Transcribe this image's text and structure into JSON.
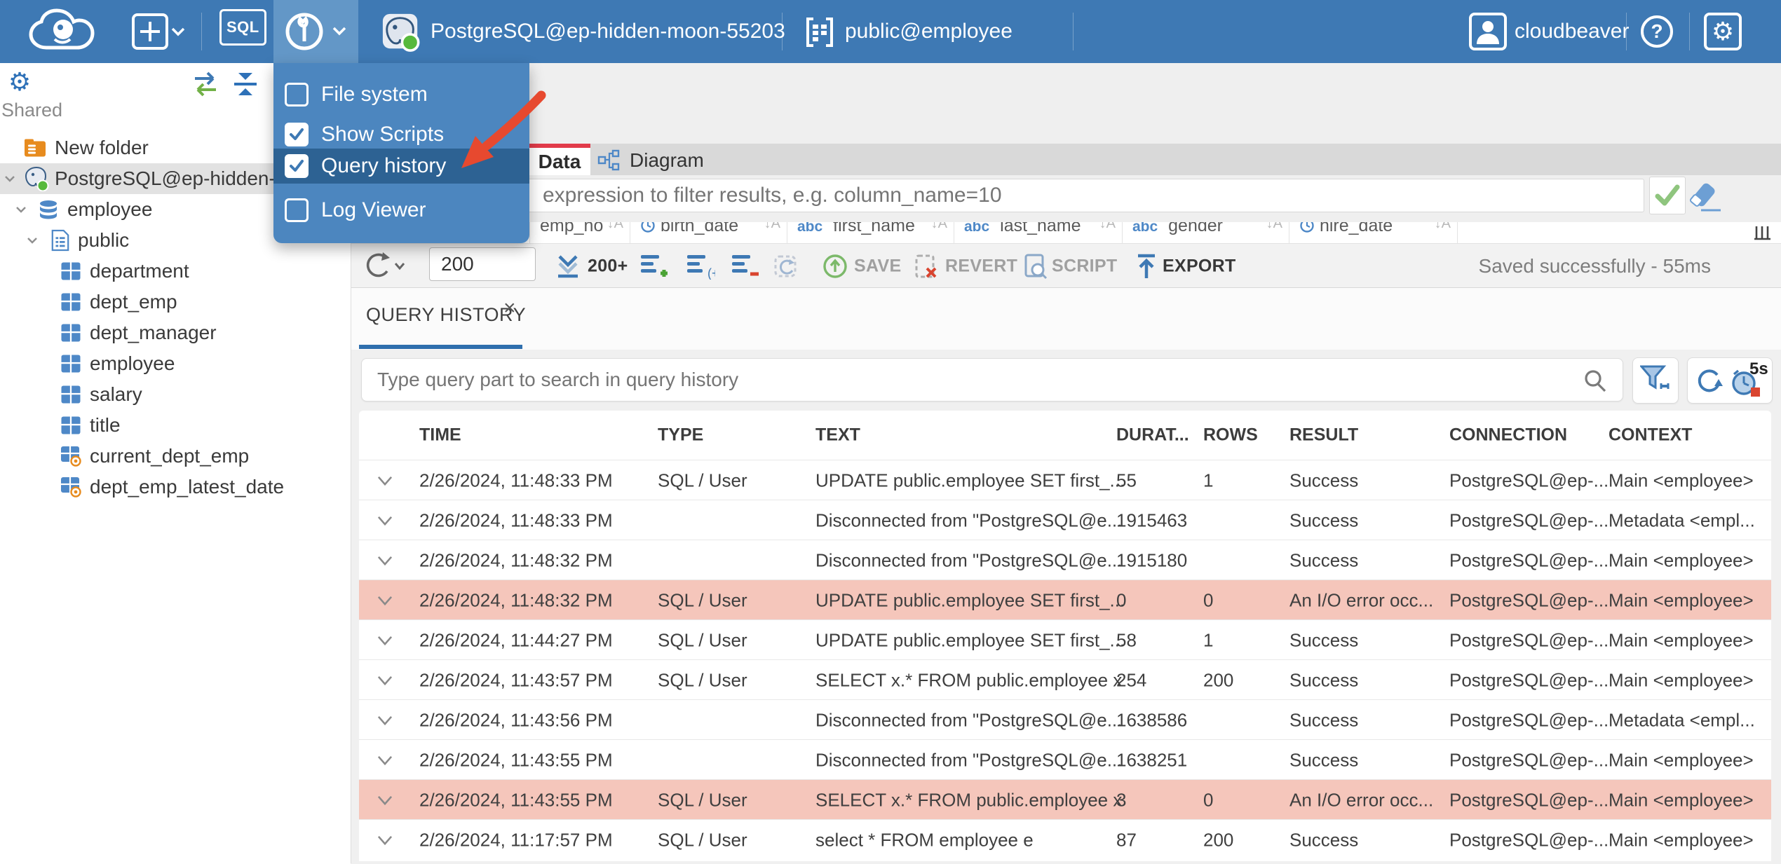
{
  "header": {
    "sql_label": "SQL",
    "connection_name": "PostgreSQL@ep-hidden-moon-55203",
    "schema_path": "public@employee",
    "username": "cloudbeaver"
  },
  "tools_menu": {
    "items": [
      {
        "label": "File system",
        "checked": false,
        "highlighted": false
      },
      {
        "label": "Show Scripts",
        "checked": true,
        "highlighted": false
      },
      {
        "label": "Query history",
        "checked": true,
        "highlighted": true
      },
      {
        "label": "Log Viewer",
        "checked": false,
        "highlighted": false
      }
    ]
  },
  "sidebar": {
    "section_label": "Shared",
    "tree": [
      {
        "label": "New folder",
        "icon": "folder-database-icon",
        "level": 0,
        "chevron": false,
        "selected": false
      },
      {
        "label": "PostgreSQL@ep-hidden-",
        "icon": "postgres-icon",
        "level": 0,
        "chevron": true,
        "selected": true
      },
      {
        "label": "employee",
        "icon": "database-icon",
        "level": 1,
        "chevron": true,
        "selected": false
      },
      {
        "label": "public",
        "icon": "schema-icon",
        "level": 2,
        "chevron": true,
        "selected": false
      },
      {
        "label": "department",
        "icon": "table-icon",
        "level": 3,
        "chevron": false,
        "selected": false
      },
      {
        "label": "dept_emp",
        "icon": "table-icon",
        "level": 3,
        "chevron": false,
        "selected": false
      },
      {
        "label": "dept_manager",
        "icon": "table-icon",
        "level": 3,
        "chevron": false,
        "selected": false
      },
      {
        "label": "employee",
        "icon": "table-icon",
        "level": 3,
        "chevron": false,
        "selected": false
      },
      {
        "label": "salary",
        "icon": "table-icon",
        "level": 3,
        "chevron": false,
        "selected": false
      },
      {
        "label": "title",
        "icon": "table-icon",
        "level": 3,
        "chevron": false,
        "selected": false
      },
      {
        "label": "current_dept_emp",
        "icon": "view-icon",
        "level": 3,
        "chevron": false,
        "selected": false
      },
      {
        "label": "dept_emp_latest_date",
        "icon": "view-icon",
        "level": 3,
        "chevron": false,
        "selected": false
      }
    ]
  },
  "object_page": {
    "tabs": [
      {
        "label": "Data",
        "active": true
      },
      {
        "label": "Diagram",
        "active": false
      }
    ],
    "filter_placeholder": "expression to filter results, e.g. column_name=10",
    "grid_columns": [
      "emp_no",
      "birth_date",
      "first_name",
      "last_name",
      "gender",
      "hire_date"
    ],
    "grid_column_icons": [
      "",
      "clock-icon",
      "abc-icon",
      "abc-icon",
      "abc-icon",
      "clock-icon"
    ],
    "toolbar": {
      "row_limit": "200",
      "fetch_more_label": "200+",
      "save_label": "SAVE",
      "revert_label": "REVERT",
      "script_label": "SCRIPT",
      "export_label": "EXPORT",
      "status_message": "Saved successfully - 55ms"
    }
  },
  "query_history": {
    "tab_label": "QUERY HISTORY",
    "close_glyph": "×",
    "search_placeholder": "Type query part to search in query history",
    "refresh_interval_badge": "5s",
    "columns": [
      "TIME",
      "TYPE",
      "TEXT",
      "DURAT...",
      "ROWS",
      "RESULT",
      "CONNECTION",
      "CONTEXT"
    ],
    "rows": [
      {
        "time": "2/26/2024, 11:48:33 PM",
        "type": "SQL / User",
        "text": "UPDATE public.employee SET first_...",
        "duration": "55",
        "rows": "1",
        "result": "Success",
        "connection": "PostgreSQL@ep-...",
        "context": "Main <employee>",
        "error": false
      },
      {
        "time": "2/26/2024, 11:48:33 PM",
        "type": "",
        "text": "Disconnected from \"PostgreSQL@e...",
        "duration": "1915463",
        "rows": "",
        "result": "Success",
        "connection": "PostgreSQL@ep-...",
        "context": "Metadata <empl...",
        "error": false
      },
      {
        "time": "2/26/2024, 11:48:32 PM",
        "type": "",
        "text": "Disconnected from \"PostgreSQL@e...",
        "duration": "1915180",
        "rows": "",
        "result": "Success",
        "connection": "PostgreSQL@ep-...",
        "context": "Main <employee>",
        "error": false
      },
      {
        "time": "2/26/2024, 11:48:32 PM",
        "type": "SQL / User",
        "text": "UPDATE public.employee SET first_...",
        "duration": "0",
        "rows": "0",
        "result": "An I/O error occ...",
        "connection": "PostgreSQL@ep-...",
        "context": "Main <employee>",
        "error": true
      },
      {
        "time": "2/26/2024, 11:44:27 PM",
        "type": "SQL / User",
        "text": "UPDATE public.employee SET first_...",
        "duration": "58",
        "rows": "1",
        "result": "Success",
        "connection": "PostgreSQL@ep-...",
        "context": "Main <employee>",
        "error": false
      },
      {
        "time": "2/26/2024, 11:43:57 PM",
        "type": "SQL / User",
        "text": "SELECT x.* FROM public.employee x",
        "duration": "254",
        "rows": "200",
        "result": "Success",
        "connection": "PostgreSQL@ep-...",
        "context": "Main <employee>",
        "error": false
      },
      {
        "time": "2/26/2024, 11:43:56 PM",
        "type": "",
        "text": "Disconnected from \"PostgreSQL@e...",
        "duration": "1638586",
        "rows": "",
        "result": "Success",
        "connection": "PostgreSQL@ep-...",
        "context": "Metadata <empl...",
        "error": false
      },
      {
        "time": "2/26/2024, 11:43:55 PM",
        "type": "",
        "text": "Disconnected from \"PostgreSQL@e...",
        "duration": "1638251",
        "rows": "",
        "result": "Success",
        "connection": "PostgreSQL@ep-...",
        "context": "Main <employee>",
        "error": false
      },
      {
        "time": "2/26/2024, 11:43:55 PM",
        "type": "SQL / User",
        "text": "SELECT x.* FROM public.employee x",
        "duration": "3",
        "rows": "0",
        "result": "An I/O error occ...",
        "connection": "PostgreSQL@ep-...",
        "context": "Main <employee>",
        "error": true
      },
      {
        "time": "2/26/2024, 11:17:57 PM",
        "type": "SQL / User",
        "text": "select * FROM employee e",
        "duration": "87",
        "rows": "200",
        "result": "Success",
        "connection": "PostgreSQL@ep-...",
        "context": "Main <employee>",
        "error": false
      }
    ]
  }
}
